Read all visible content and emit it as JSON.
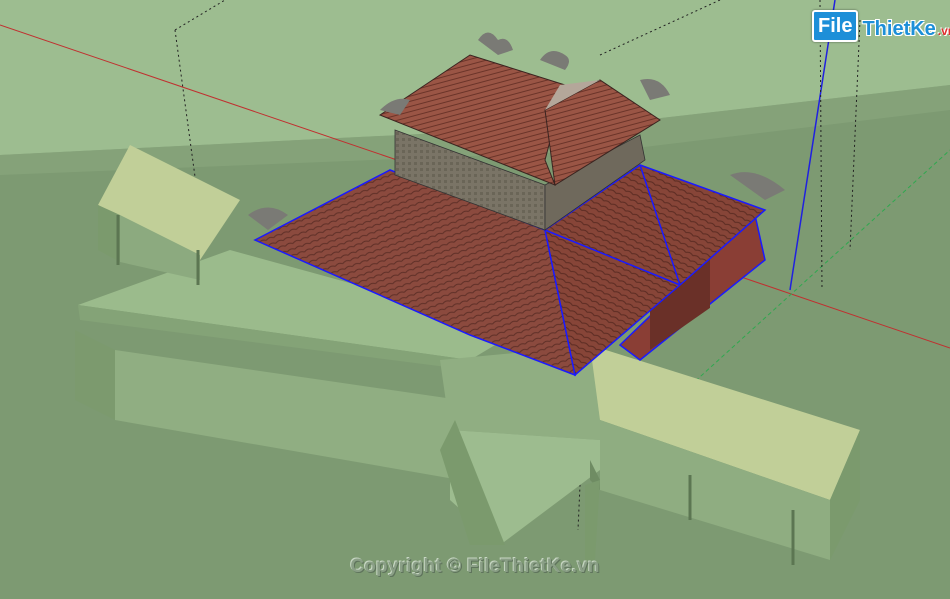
{
  "logo": {
    "mark": "File",
    "word": "ThietKe",
    "tld": ".vn",
    "colors": {
      "mark_bg": "#1d8fd8",
      "tld": "#e03030"
    }
  },
  "watermark": {
    "text": "Copyright © FileThietKe.vn"
  },
  "scene": {
    "ground_color": "#7d9a72",
    "sky_color": "#9dbd90",
    "roof_tile_color": "#8b4a3e",
    "selection_color": "#1a1aff",
    "axis_colors": {
      "red": "#c03030",
      "green": "#2fa84f",
      "blue": "#2020e0"
    }
  }
}
